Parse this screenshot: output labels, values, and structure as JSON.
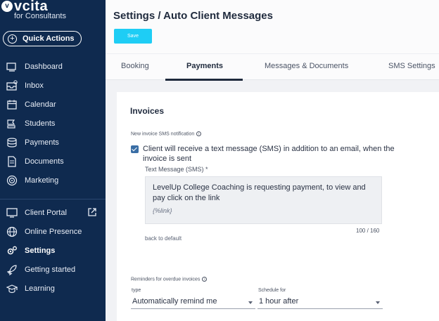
{
  "brand": {
    "name": "vcita",
    "subtitle": "for Consultants"
  },
  "quick_actions": {
    "label": "Quick Actions"
  },
  "sidebar": {
    "items": [
      {
        "label": "Dashboard",
        "icon": "dashboard-icon"
      },
      {
        "label": "Inbox",
        "icon": "inbox-icon"
      },
      {
        "label": "Calendar",
        "icon": "calendar-icon"
      },
      {
        "label": "Students",
        "icon": "students-icon"
      },
      {
        "label": "Payments",
        "icon": "payments-icon"
      },
      {
        "label": "Documents",
        "icon": "documents-icon"
      },
      {
        "label": "Marketing",
        "icon": "marketing-icon"
      },
      {
        "label": "Client Portal",
        "icon": "client-portal-icon"
      },
      {
        "label": "Online Presence",
        "icon": "globe-icon"
      },
      {
        "label": "Settings",
        "icon": "gear-icon",
        "active": true
      },
      {
        "label": "Getting started",
        "icon": "rocket-icon"
      },
      {
        "label": "Learning",
        "icon": "graduation-cap-icon"
      }
    ]
  },
  "header": {
    "title": "Settings / Auto Client Messages",
    "save_label": "Save"
  },
  "tabs": [
    {
      "label": "Booking"
    },
    {
      "label": "Payments",
      "active": true
    },
    {
      "label": "Messages & Documents"
    },
    {
      "label": "SMS Settings"
    }
  ],
  "invoices": {
    "title": "Invoices",
    "new_invoice_label": "New invoice SMS notification",
    "checkbox_text": "Client will receive a text message (SMS) in addition to an email, when the invoice is sent",
    "checkbox_checked": true,
    "sms_label": "Text Message (SMS) *",
    "sms_text": "LevelUp College Coaching is requesting payment, to view and pay click on the link",
    "sms_link": "{%link}",
    "counter": "100 / 160",
    "back_to_default": "back to default",
    "reminders_label": "Reminders for overdue invoices",
    "type_label": "type",
    "type_value": "Automatically remind me",
    "schedule_label": "Schedule for",
    "schedule_value": "1 hour after"
  },
  "colors": {
    "sidebar_bg": "#0f2a4f",
    "save_button": "#1ecdf5",
    "checkbox": "#3a6ea5"
  }
}
